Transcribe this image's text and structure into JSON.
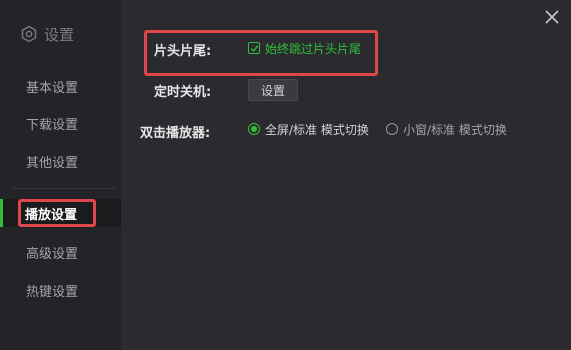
{
  "sidebar": {
    "title": "设置",
    "items": [
      {
        "label": "基本设置"
      },
      {
        "label": "下载设置"
      },
      {
        "label": "其他设置"
      },
      {
        "label": "播放设置"
      },
      {
        "label": "高级设置"
      },
      {
        "label": "热键设置"
      }
    ],
    "active_index": 3
  },
  "content": {
    "skip_row": {
      "label": "片头片尾:",
      "checkbox_label": "始终跳过片头片尾",
      "checked": true
    },
    "timer_row": {
      "label": "定时关机:",
      "button_label": "设置"
    },
    "doubleclick_row": {
      "label": "双击播放器:",
      "options": [
        {
          "label": "全屏/标准 模式切换",
          "selected": true
        },
        {
          "label": "小窗/标准 模式切换",
          "selected": false
        }
      ]
    }
  },
  "colors": {
    "accent": "#2fbf3a",
    "highlight": "#e0474a",
    "background": "#2b2b2f",
    "sidebar_bg": "#242428"
  },
  "icons": {
    "title": "gear-icon",
    "close": "close-icon",
    "check": "checkmark-icon"
  }
}
